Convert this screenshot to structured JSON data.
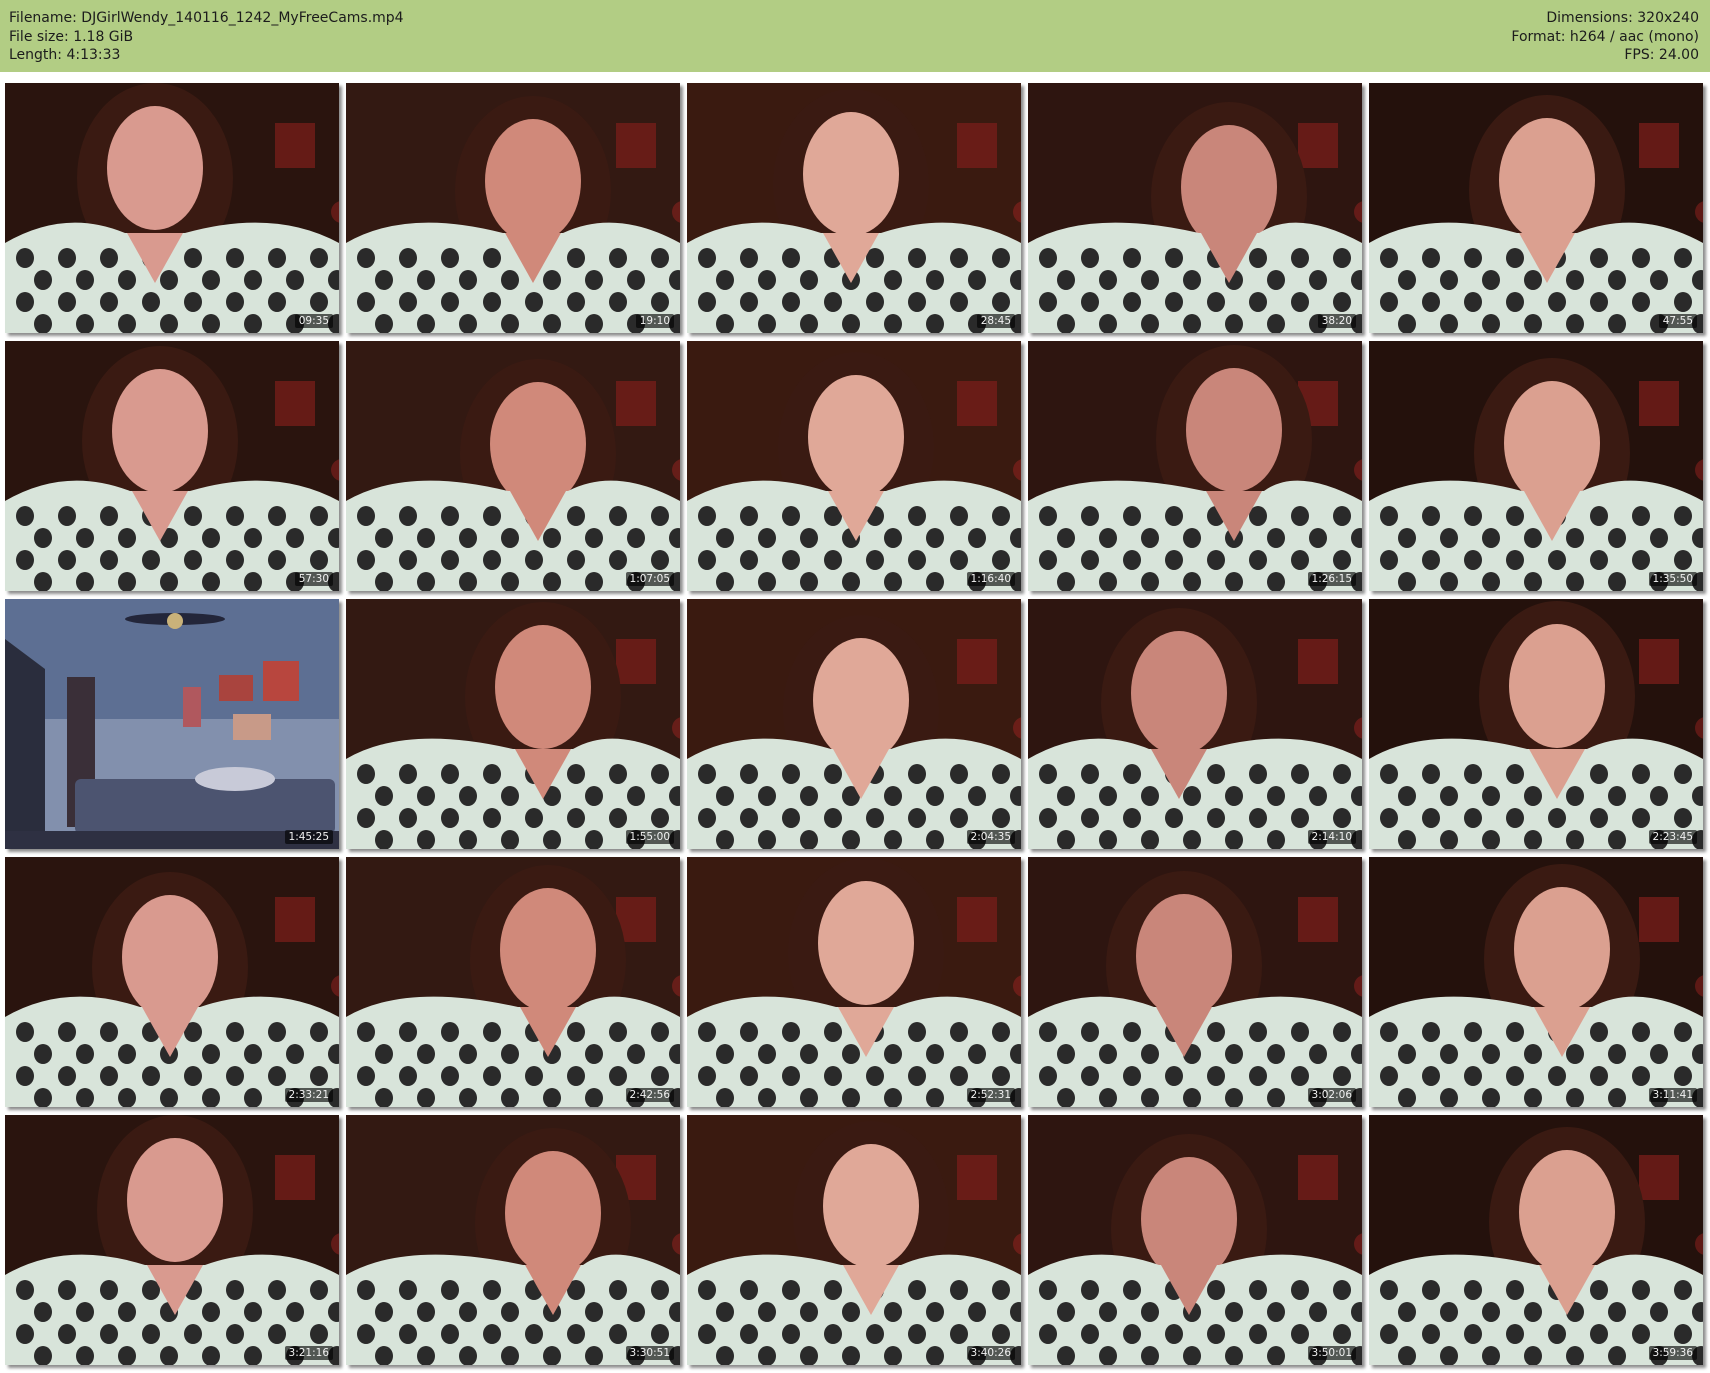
{
  "header": {
    "filename": "Filename: DJGirlWendy_140116_1242_MyFreeCams.mp4",
    "filesize": "File size: 1.18 GiB",
    "length": "Length: 4:13:33",
    "dimensions": "Dimensions: 320x240",
    "format": "Format: h264 / aac (mono)",
    "fps": "FPS: 24.00",
    "bg_color": "#b2cd84"
  },
  "thumbnails": [
    {
      "timestamp": "09:35",
      "scene": "person"
    },
    {
      "timestamp": "19:10",
      "scene": "person"
    },
    {
      "timestamp": "28:45",
      "scene": "person"
    },
    {
      "timestamp": "38:20",
      "scene": "person"
    },
    {
      "timestamp": "47:55",
      "scene": "person"
    },
    {
      "timestamp": "57:30",
      "scene": "person"
    },
    {
      "timestamp": "1:07:05",
      "scene": "person"
    },
    {
      "timestamp": "1:16:40",
      "scene": "person"
    },
    {
      "timestamp": "1:26:15",
      "scene": "person"
    },
    {
      "timestamp": "1:35:50",
      "scene": "person"
    },
    {
      "timestamp": "1:45:25",
      "scene": "room"
    },
    {
      "timestamp": "1:55:00",
      "scene": "person"
    },
    {
      "timestamp": "2:04:35",
      "scene": "person"
    },
    {
      "timestamp": "2:14:10",
      "scene": "person"
    },
    {
      "timestamp": "2:23:45",
      "scene": "person"
    },
    {
      "timestamp": "2:33:21",
      "scene": "person"
    },
    {
      "timestamp": "2:42:56",
      "scene": "person"
    },
    {
      "timestamp": "2:52:31",
      "scene": "person"
    },
    {
      "timestamp": "3:02:06",
      "scene": "person"
    },
    {
      "timestamp": "3:11:41",
      "scene": "person"
    },
    {
      "timestamp": "3:21:16",
      "scene": "person"
    },
    {
      "timestamp": "3:30:51",
      "scene": "person"
    },
    {
      "timestamp": "3:40:26",
      "scene": "person"
    },
    {
      "timestamp": "3:50:01",
      "scene": "person"
    },
    {
      "timestamp": "3:59:36",
      "scene": "person"
    }
  ]
}
